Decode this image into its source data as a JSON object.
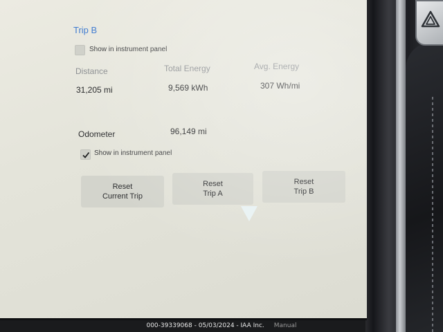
{
  "trip_b": {
    "title": "Trip B",
    "show_in_panel": {
      "label": "Show in instrument panel",
      "checked": false
    },
    "stats": [
      {
        "label": "Distance",
        "value": "31,205 mi"
      },
      {
        "label": "Total Energy",
        "value": "9,569 kWh"
      },
      {
        "label": "Avg. Energy",
        "value": "307 Wh/mi"
      }
    ]
  },
  "odometer": {
    "label": "Odometer",
    "value": "96,149 mi",
    "show_in_panel": {
      "label": "Show in instrument panel",
      "checked": true
    }
  },
  "buttons": {
    "reset_current": "Reset\nCurrent Trip",
    "reset_a": "Reset\nTrip A",
    "reset_b": "Reset\nTrip B"
  },
  "watermark": {
    "text": "000-39339068 - 05/03/2024 - IAA Inc.",
    "manual": "Manual"
  },
  "colors": {
    "section_title": "#3f7bd0",
    "screen_bg": "#e6e6dc",
    "button_bg": "#d3d4cc"
  },
  "icons": {
    "hazard": "hazard-triangle-icon",
    "check": "checkmark-icon"
  }
}
